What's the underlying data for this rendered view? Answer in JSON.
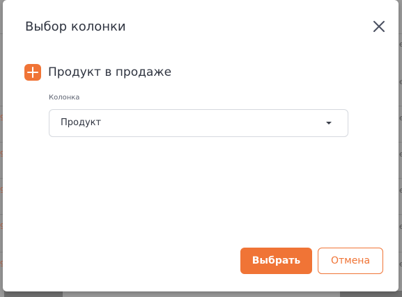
{
  "dialog": {
    "title": "Выбор колонки",
    "close_icon": "close-icon"
  },
  "section": {
    "icon": "plus-icon",
    "title": "Продукт в продаже"
  },
  "column_field": {
    "label": "Колонка",
    "selected_value": "Продукт"
  },
  "actions": {
    "confirm_label": "Выбрать",
    "cancel_label": "Отмена"
  },
  "colors": {
    "accent": "#f07436",
    "text": "#2f3440",
    "overlay": "#9a9a9a"
  }
}
